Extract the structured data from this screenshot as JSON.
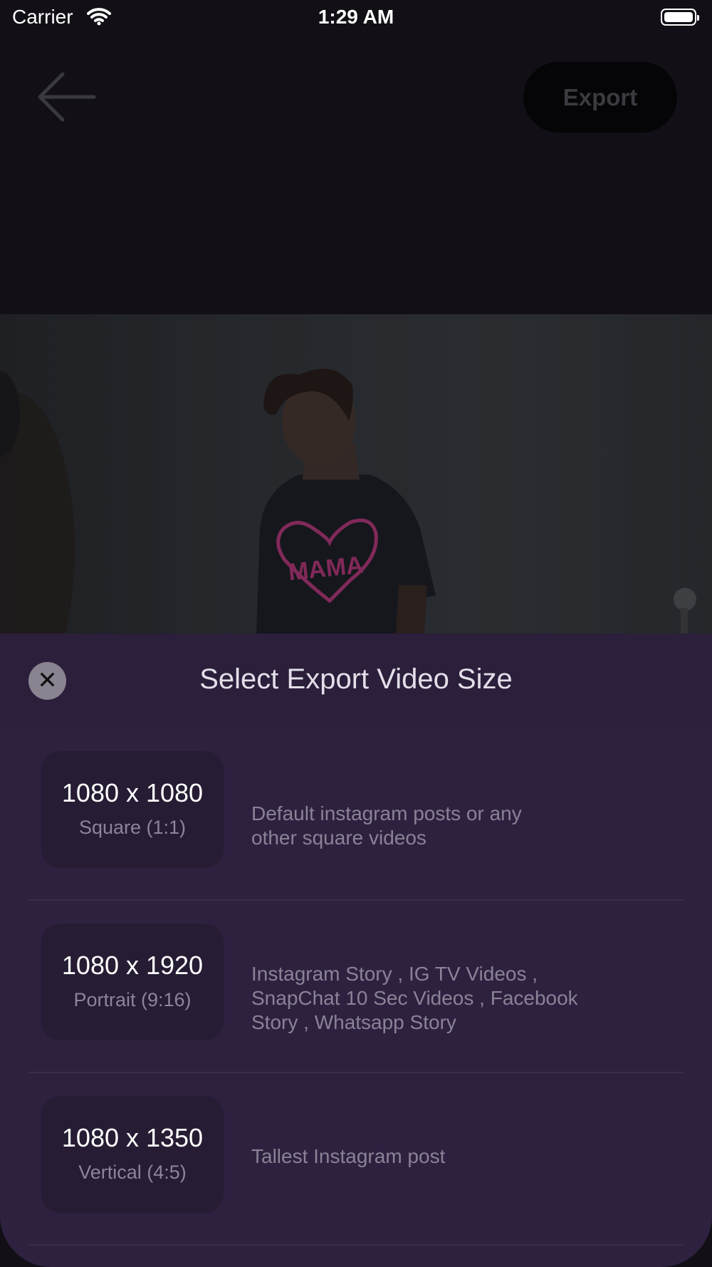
{
  "status_bar": {
    "carrier": "Carrier",
    "time": "1:29 AM"
  },
  "toolbar": {
    "back_icon": "arrow-left-icon",
    "export_label": "Export"
  },
  "video": {
    "shirt_text": "MAMA"
  },
  "sheet": {
    "close_icon": "close-icon",
    "close_glyph": "✕",
    "title": "Select Export Video Size",
    "options": [
      {
        "size": "1080 x 1080",
        "ratio": "Square (1:1)",
        "description": "Default instagram posts or any other square videos"
      },
      {
        "size": "1080 x 1920",
        "ratio": "Portrait (9:16)",
        "description": "Instagram Story , IG TV Videos , SnapChat 10 Sec Videos , Facebook Story , Whatsapp Story"
      },
      {
        "size": "1080 x 1350",
        "ratio": "Vertical (4:5)",
        "description": "Tallest Instagram post"
      }
    ]
  },
  "colors": {
    "sheet_background": "#2e2140",
    "sheet_header": "#2b1f3c",
    "card_background": "#261c33",
    "heart": "#c23b82"
  }
}
